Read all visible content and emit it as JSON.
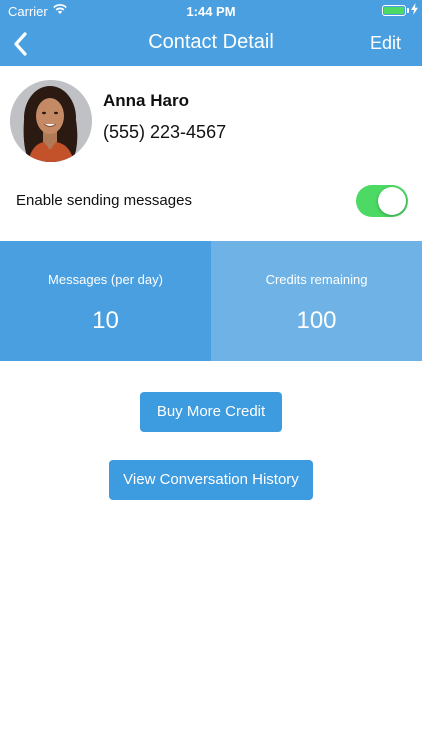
{
  "status_bar": {
    "carrier": "Carrier",
    "time": "1:44 PM"
  },
  "nav": {
    "title": "Contact Detail",
    "edit_label": "Edit"
  },
  "contact": {
    "name": "Anna Haro",
    "phone": "(555) 223-4567"
  },
  "messaging": {
    "toggle_label": "Enable sending messages",
    "enabled": true
  },
  "stats": [
    {
      "label": "Messages (per day)",
      "value": "10"
    },
    {
      "label": "Credits remaining",
      "value": "100"
    }
  ],
  "buttons": {
    "buy_credit": "Buy More Credit",
    "view_history": "View Conversation History"
  },
  "colors": {
    "accent": "#4a9fe0",
    "accent_light": "#6fb3e6",
    "toggle_on": "#4cd964"
  },
  "icons": [
    "wifi-icon",
    "battery-icon",
    "back-chevron-icon",
    "avatar-photo"
  ]
}
